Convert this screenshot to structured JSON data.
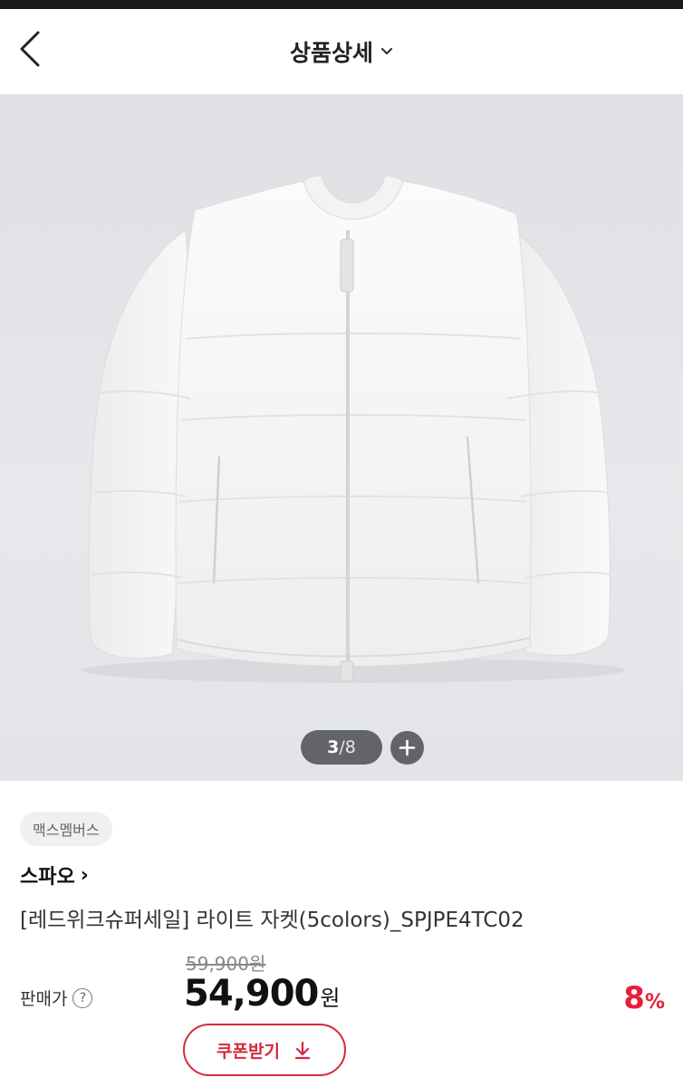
{
  "header": {
    "title": "상품상세",
    "back_icon": "chevron-left-icon",
    "dropdown_icon": "chevron-down-icon"
  },
  "gallery": {
    "current": "3",
    "separator": "/",
    "total": "8",
    "zoom_icon": "plus-icon"
  },
  "product": {
    "badge": "맥스멤버스",
    "brand": "스파오",
    "brand_arrow": "›",
    "name": "[레드위크슈퍼세일] 라이트 자켓(5colors)_SPJPE4TC02",
    "original_price": "59,900원",
    "price_label": "판매가",
    "help_symbol": "?",
    "sale_price": "54,900",
    "currency": "원",
    "discount_value": "8",
    "discount_unit": "%",
    "coupon_label": "쿠폰받기"
  },
  "colors": {
    "accent": "#d42a3c",
    "discount": "#e5203a"
  }
}
